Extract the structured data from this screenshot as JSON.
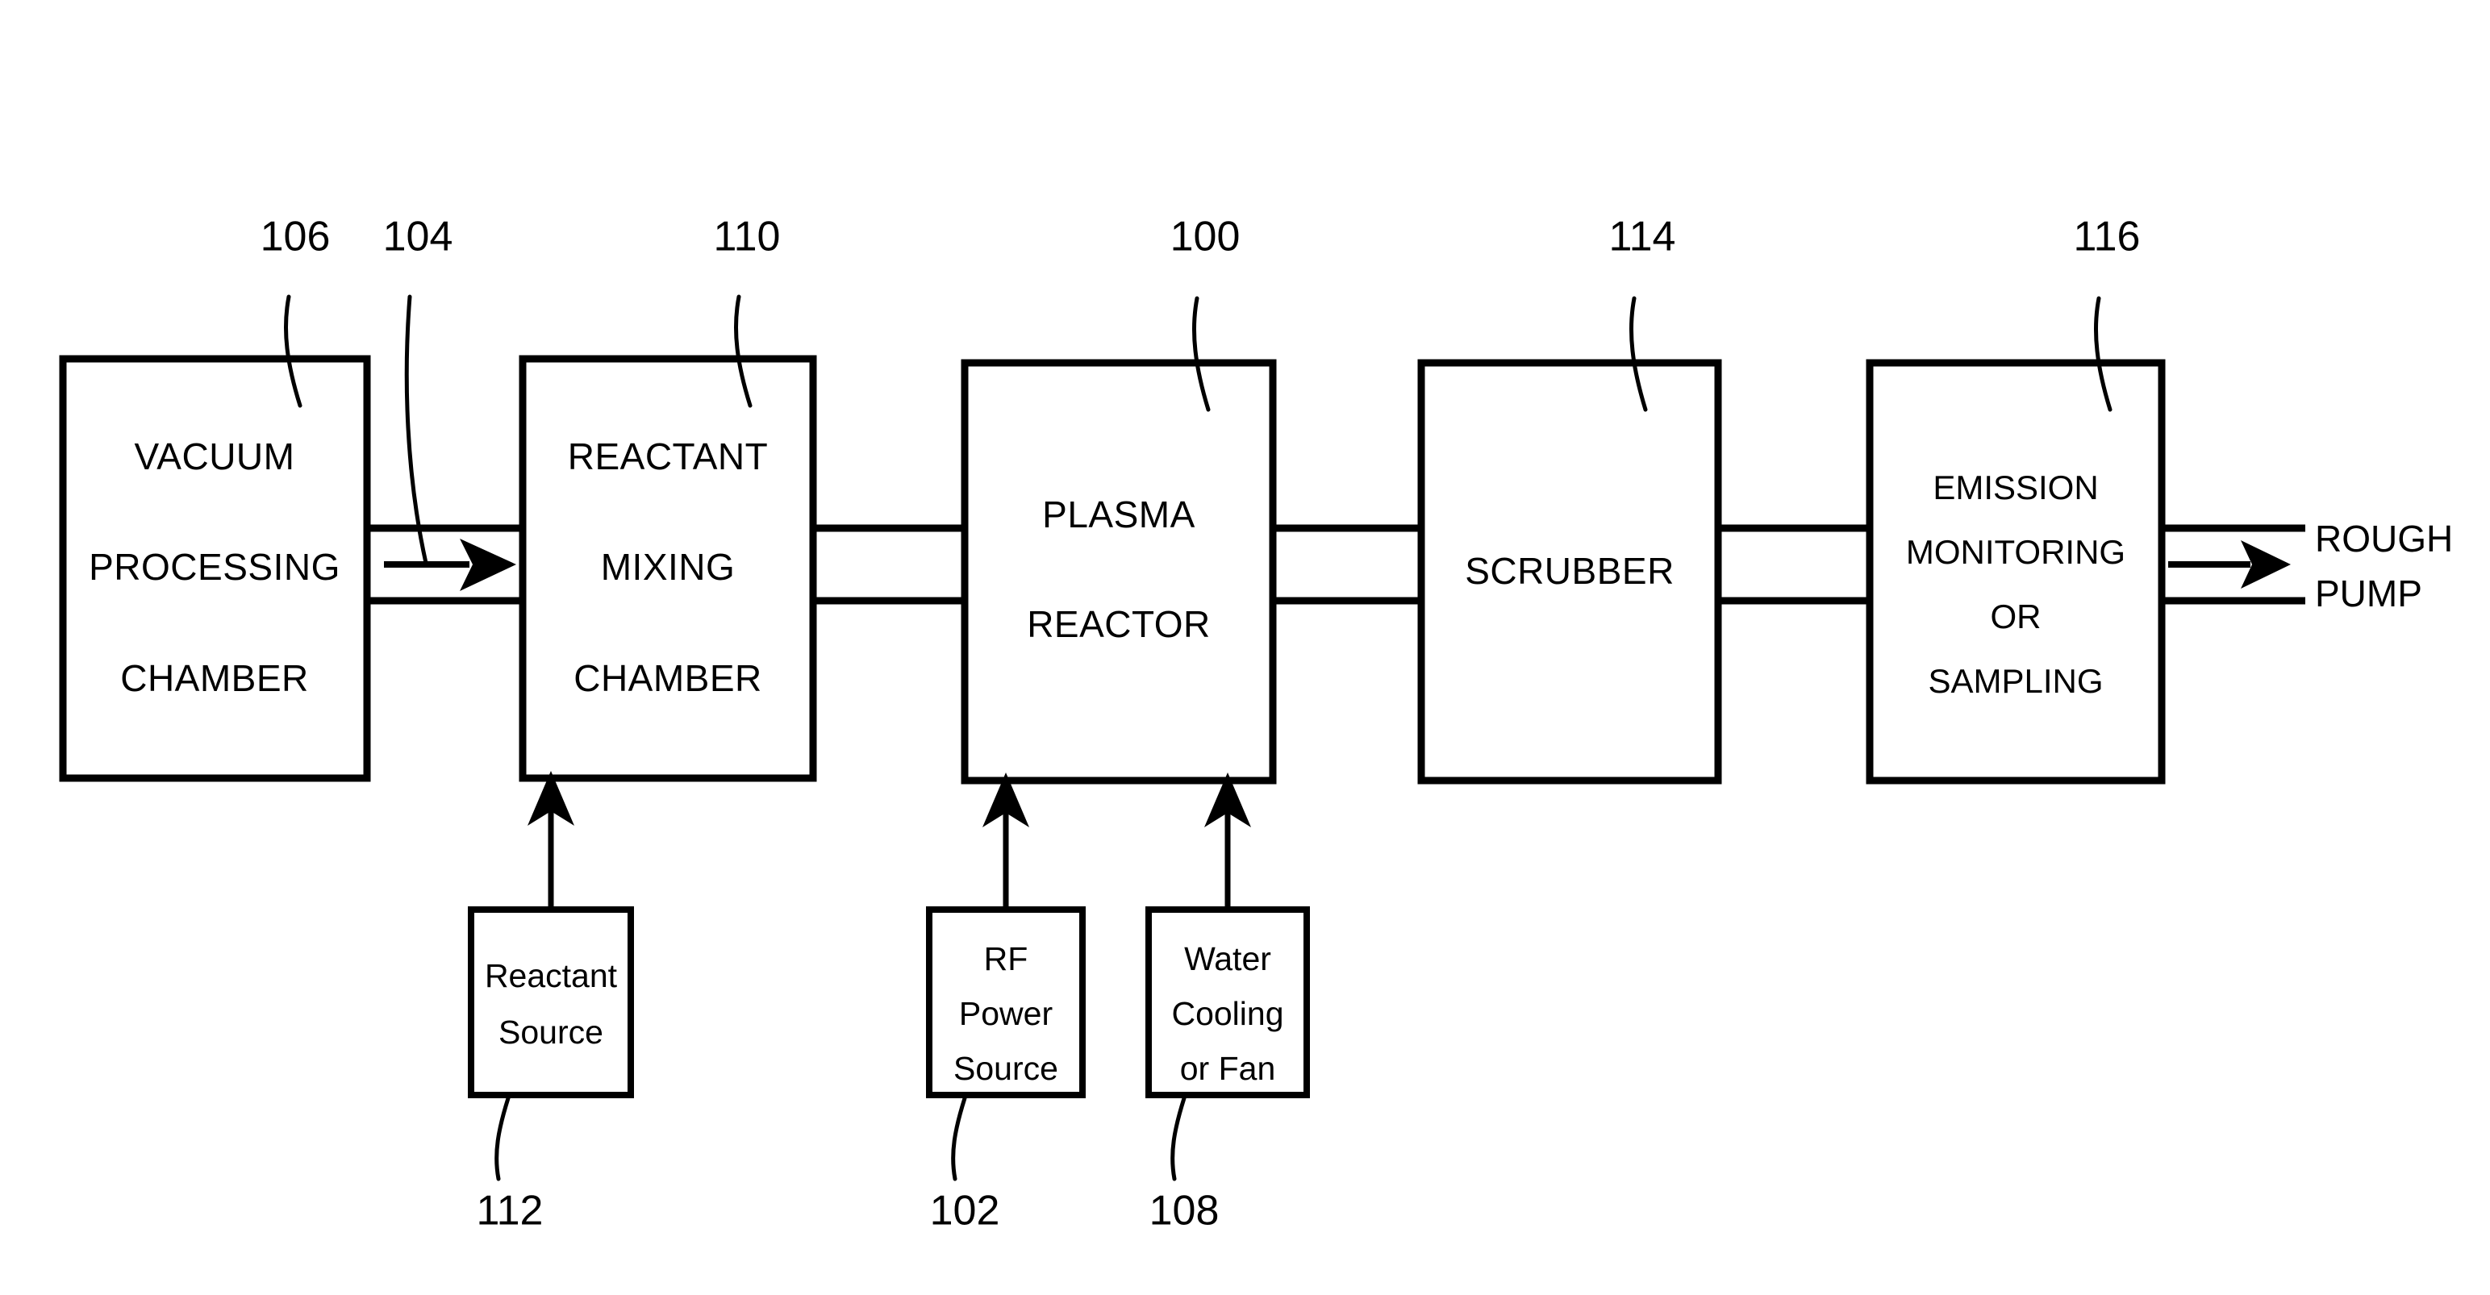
{
  "figure": {
    "type": "patent-block-diagram",
    "background_color": "#ffffff",
    "line_color": "#000000"
  },
  "main_blocks": [
    {
      "id": "vacuum-processing-chamber",
      "ref": "106",
      "lines": [
        "VACUUM",
        "PROCESSING",
        "CHAMBER"
      ]
    },
    {
      "id": "reactant-mixing-chamber",
      "ref": "110",
      "lines": [
        "REACTANT",
        "MIXING",
        "CHAMBER"
      ]
    },
    {
      "id": "plasma-reactor",
      "ref": "100",
      "lines": [
        "PLASMA",
        "REACTOR"
      ]
    },
    {
      "id": "scrubber",
      "ref": "114",
      "lines": [
        "SCRUBBER"
      ]
    },
    {
      "id": "emission-monitoring",
      "ref": "116",
      "lines": [
        "EMISSION",
        "MONITORING",
        "OR",
        "SAMPLING"
      ]
    }
  ],
  "source_blocks": [
    {
      "id": "reactant-source",
      "ref": "112",
      "lines": [
        "Reactant",
        "Source"
      ]
    },
    {
      "id": "rf-power-source",
      "ref": "102",
      "lines": [
        "RF",
        "Power",
        "Source"
      ]
    },
    {
      "id": "water-cooling-or-fan",
      "ref": "108",
      "lines": [
        "Water",
        "Cooling",
        "or Fan"
      ]
    }
  ],
  "external_labels": [
    {
      "id": "rough-pump",
      "lines": [
        "ROUGH",
        "PUMP"
      ]
    }
  ],
  "flow_refs": [
    {
      "id": "gas-flow-104",
      "ref": "104"
    }
  ],
  "reference_numerals": [
    "106",
    "104",
    "110",
    "100",
    "114",
    "116",
    "112",
    "102",
    "108"
  ],
  "text": {
    "b1_l1": "VACUUM",
    "b1_l2": "PROCESSING",
    "b1_l3": "CHAMBER",
    "b2_l1": "REACTANT",
    "b2_l2": "MIXING",
    "b2_l3": "CHAMBER",
    "b3_l1": "PLASMA",
    "b3_l2": "REACTOR",
    "b4_l1": "SCRUBBER",
    "b5_l1": "EMISSION",
    "b5_l2": "MONITORING",
    "b5_l3": "OR",
    "b5_l4": "SAMPLING",
    "s1_l1": "Reactant",
    "s1_l2": "Source",
    "s2_l1": "RF",
    "s2_l2": "Power",
    "s2_l3": "Source",
    "s3_l1": "Water",
    "s3_l2": "Cooling",
    "s3_l3": "or Fan",
    "ext_l1": "ROUGH",
    "ext_l2": "PUMP",
    "n106": "106",
    "n104": "104",
    "n110": "110",
    "n100": "100",
    "n114": "114",
    "n116": "116",
    "n112": "112",
    "n102": "102",
    "n108": "108"
  }
}
